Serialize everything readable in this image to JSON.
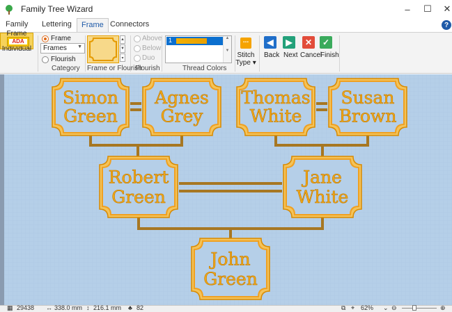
{
  "window": {
    "title": "Family Tree Wizard",
    "minimize": "–",
    "maximize": "☐",
    "close": "✕"
  },
  "tabs": [
    {
      "label": "Family"
    },
    {
      "label": "Lettering"
    },
    {
      "label": "Frame",
      "active": true
    },
    {
      "label": "Connectors"
    }
  ],
  "help_label": "?",
  "ribbon": {
    "frame_each": {
      "icon_text": "ADA",
      "label_line1": "Frame Each",
      "label_line2": "Individual"
    },
    "category": {
      "group_label": "Category",
      "option_frame": "Frame",
      "option_flourish": "Flourish",
      "selected": "Frame",
      "dropdown_value": "Frames"
    },
    "frame_or_flourish": {
      "group_label": "Frame or Flourish"
    },
    "flourish": {
      "group_label": "Flourish",
      "options": [
        "Above",
        "Below",
        "Duo"
      ]
    },
    "thread_colors": {
      "group_label": "Thread Colors",
      "selected_index": "1",
      "swatch_color": "#f4b000"
    },
    "stitch_type": {
      "label_line1": "Stitch",
      "label_line2": "Type ▾"
    },
    "nav": {
      "back": "Back",
      "next": "Next",
      "cancel": "Cancel",
      "finish": "Finish"
    }
  },
  "tree": {
    "people": [
      {
        "first": "Simon",
        "last": "Green"
      },
      {
        "first": "Agnes",
        "last": "Grey"
      },
      {
        "first": "Thomas",
        "last": "White"
      },
      {
        "first": "Susan",
        "last": "Brown"
      },
      {
        "first": "Robert",
        "last": "Green"
      },
      {
        "first": "Jane",
        "last": "White"
      },
      {
        "first": "John",
        "last": "Green"
      }
    ],
    "frame_color": "#f0a020",
    "text_color": "#f2a818",
    "connector_color": "#a77722",
    "background": "#b5cfe8"
  },
  "status": {
    "stitches": "29438",
    "width": "338.0 mm",
    "height": "216.1 mm",
    "colors": "82",
    "zoom": "62%"
  }
}
